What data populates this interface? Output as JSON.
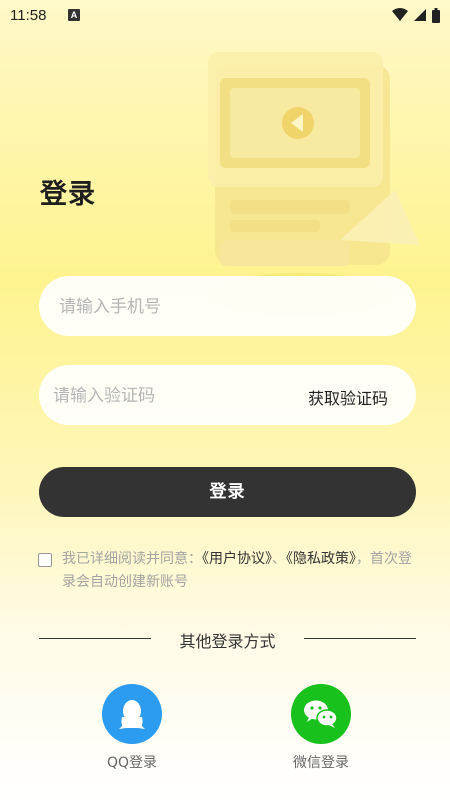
{
  "status_bar": {
    "time": "11:58",
    "notification_icon": "A"
  },
  "login": {
    "title": "登录",
    "phone_placeholder": "请输入手机号",
    "code_placeholder": "请输入验证码",
    "get_code_label": "获取验证码",
    "submit_label": "登录"
  },
  "agreement": {
    "prefix": "我已详细阅读并同意：",
    "user_agreement": "《用户协议》",
    "separator": "、",
    "privacy_policy": "《隐私政策》",
    "suffix": "，首次登录会自动创建新账号"
  },
  "other_login": {
    "heading": "其他登录方式",
    "qq_label": "QQ登录",
    "wechat_label": "微信登录"
  },
  "colors": {
    "primary_button": "#333333",
    "qq_blue": "#2c9cf0",
    "wechat_green": "#18c11b"
  }
}
